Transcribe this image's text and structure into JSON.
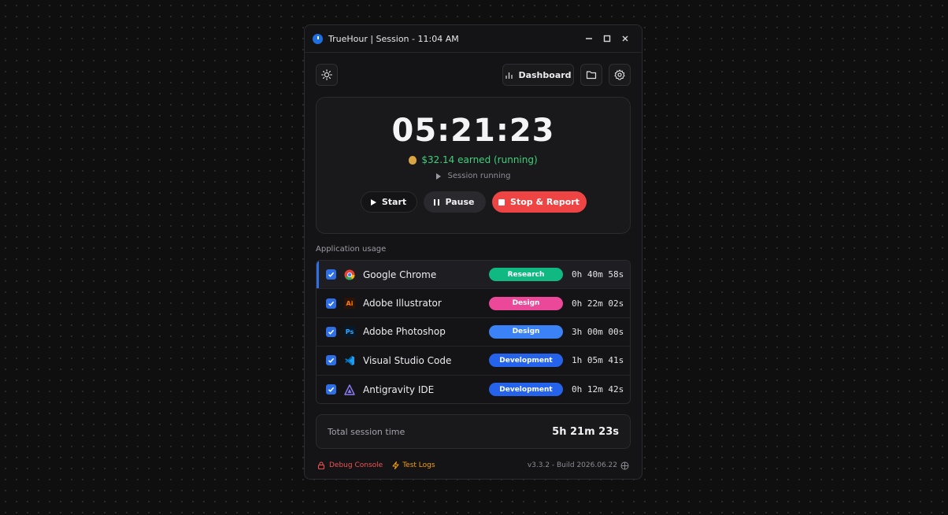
{
  "window": {
    "title": "TrueHour | Session - 11:04 AM",
    "controls": [
      "minimize",
      "maximize",
      "close"
    ]
  },
  "toolbar": {
    "theme_icon": "sun-icon",
    "dashboard_label": "Dashboard",
    "folder_icon": "folder-icon",
    "settings_icon": "gear-icon"
  },
  "timer": {
    "clock": "05:21:23",
    "earned": "$32.14 earned (running)",
    "status": "Session running",
    "start_label": "Start",
    "pause_label": "Pause",
    "stop_label": "Stop & Report"
  },
  "usage": {
    "section_label": "Application usage",
    "apps": [
      {
        "name": "Google Chrome",
        "category": "Research",
        "color": "#10b981",
        "duration": "0h 40m 58s",
        "checked": true,
        "icon": "chrome-icon"
      },
      {
        "name": "Adobe Illustrator",
        "category": "Design",
        "color": "#ec4899",
        "duration": "0h 22m 02s",
        "checked": true,
        "icon": "illustrator-icon"
      },
      {
        "name": "Adobe Photoshop",
        "category": "Design",
        "color": "#3b82f6",
        "duration": "3h 00m 00s",
        "checked": true,
        "icon": "photoshop-icon"
      },
      {
        "name": "Visual Studio Code",
        "category": "Development",
        "color": "#2563eb",
        "duration": "1h 05m 41s",
        "checked": true,
        "icon": "vscode-icon"
      },
      {
        "name": "Antigravity IDE",
        "category": "Development",
        "color": "#2563eb",
        "duration": "0h 12m 42s",
        "checked": true,
        "icon": "antigravity-icon"
      }
    ]
  },
  "total": {
    "label": "Total session time",
    "value": "5h 21m 23s"
  },
  "footer": {
    "debug_label": "Debug Console",
    "logs_label": "Test Logs",
    "version": "v3.3.2 - Build 2026.06.22"
  },
  "colors": {
    "accent": "#2f6fe6",
    "earned": "#3fd07a",
    "stop": "#ef4444",
    "debug": "#f05252",
    "logs": "#f59e0b"
  }
}
